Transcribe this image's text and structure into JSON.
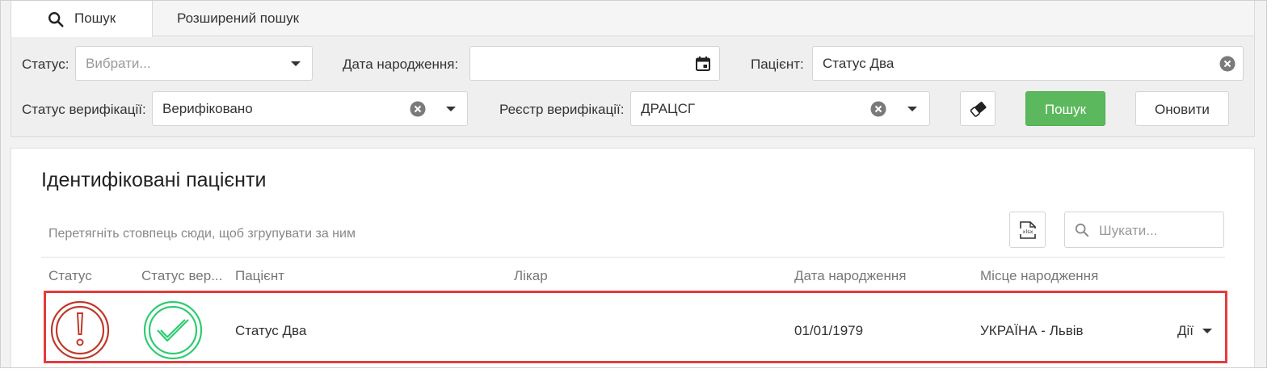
{
  "tabs": {
    "search_label": "Пошук",
    "advanced_label": "Розширений пошук"
  },
  "filters": {
    "status_label": "Статус:",
    "status_placeholder": "Вибрати...",
    "birth_date_label": "Дата народження:",
    "birth_date_value": "",
    "patient_label": "Пацієнт:",
    "patient_value": "Статус Два",
    "verification_status_label": "Статус верифікації:",
    "verification_status_value": "Верифіковано",
    "verification_registry_label": "Реєстр верифікації:",
    "verification_registry_value": "ДРАЦСГ"
  },
  "buttons": {
    "search_label": "Пошук",
    "refresh_label": "Оновити",
    "eraser_icon": "eraser-icon"
  },
  "results": {
    "title": "Ідентифіковані пацієнти",
    "group_hint": "Перетягніть стовпець сюди, щоб згрупувати за ним",
    "search_placeholder": "Шукати...",
    "export_icon": "xlsx-export-icon",
    "columns": [
      "Статус",
      "Статус вер...",
      "Пацієнт",
      "Лікар",
      "Дата народження",
      "Місце народження"
    ],
    "rows": [
      {
        "status_icon": "alert-circle-icon",
        "verification_icon": "check-circle-icon",
        "patient": "Статус Два",
        "doctor": "",
        "birth_date": "01/01/1979",
        "birth_place": "УКРАЇНА - Львів",
        "actions_label": "Дії"
      }
    ]
  },
  "colors": {
    "search_button": "#5cb85c",
    "status_error": "#c0392b",
    "verified": "#2ecc71",
    "row_highlight": "#e53b3b"
  }
}
